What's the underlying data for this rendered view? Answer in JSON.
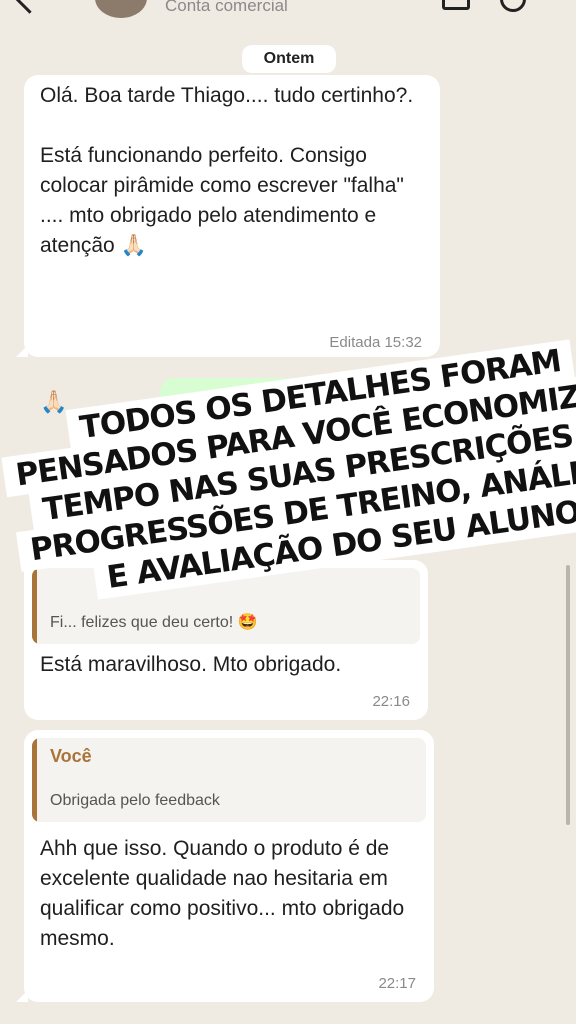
{
  "header": {
    "subtitle": "Conta comercial",
    "icons": [
      "back-icon",
      "video-icon",
      "call-icon"
    ]
  },
  "date_chip": "Ontem",
  "messages": [
    {
      "text": "Olá. Boa tarde Thiago.... tudo certinho?.\n\nEstá funcionando perfeito. Consigo colocar pirâmide como escrever \"falha\" .... mto obrigado pelo atendimento e atenção 🙏🏻",
      "emoji_line": "🙏🏻",
      "time": "Editada 15:32"
    },
    {
      "quote_text": "Fi... felizes que deu certo! 🤩",
      "text": "Está maravilhoso. Mto obrigado.",
      "time": "22:16"
    },
    {
      "quote_author": "Você",
      "quote_text": "Obrigada pelo feedback",
      "text": "Ahh que isso. Quando o produto é de excelente qualidade nao hesitaria em qualificar como positivo... mto obrigado mesmo.",
      "time": "22:17"
    }
  ],
  "banner": {
    "lines": [
      "TODOS OS DETALHES FORAM",
      "PENSADOS PARA VOCÊ ECONOMIZAR",
      "TEMPO NAS SUAS PRESCRIÇÕES,",
      "PROGRESSÕES DE TREINO, ANÁLISE",
      "E AVALIAÇÃO DO SEU ALUNO"
    ]
  },
  "colors": {
    "background": "#efeae2",
    "bubble": "#ffffff",
    "outgoing_bubble": "#d9fdd3",
    "quote_accent": "#a8743a"
  }
}
